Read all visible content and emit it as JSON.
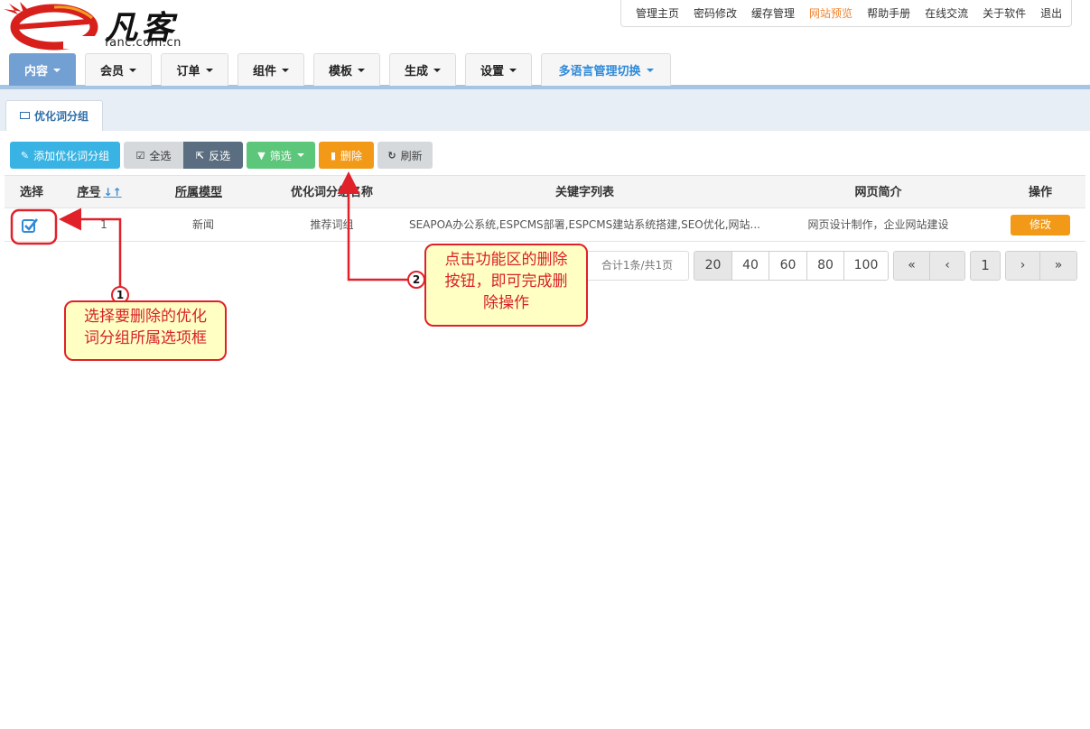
{
  "logo": {
    "text": "凡客",
    "domain": "fanc.com.cn"
  },
  "toplinks": [
    "管理主页",
    "密码修改",
    "缓存管理",
    "网站预览",
    "帮助手册",
    "在线交流",
    "关于软件",
    "退出"
  ],
  "nav": [
    "内容",
    "会员",
    "订单",
    "组件",
    "模板",
    "生成",
    "设置",
    "多语言管理切换"
  ],
  "subtab": {
    "label": "优化词分组",
    "icon": "monitor-icon"
  },
  "toolbar": {
    "add": "添加优化词分组",
    "select_all": "全选",
    "invert": "反选",
    "filter": "筛选",
    "delete": "删除",
    "refresh": "刷新"
  },
  "table": {
    "headers": [
      "选择",
      "序号",
      "所属模型",
      "优化词分组名称",
      "关键字列表",
      "网页简介",
      "操作"
    ],
    "row": {
      "checked": true,
      "id": "1",
      "model": "新闻",
      "name": "推荐词组",
      "keywords": "SEAPOA办公系统,ESPCMS部署,ESPCMS建站系统搭建,SEO优化,网站...",
      "intro": "网页设计制作，企业网站建设",
      "action": "修改"
    }
  },
  "pager": {
    "count": "合计1条/共1页",
    "sizes": [
      "20",
      "40",
      "60",
      "80",
      "100"
    ],
    "active_size": "20",
    "first": "«",
    "prev": "‹",
    "page": "1",
    "next": "›",
    "last": "»"
  },
  "callouts": {
    "one": {
      "num": "1",
      "text1": "选择要删除的优化",
      "text2": "词分组所属选项框"
    },
    "two": {
      "num": "2",
      "text1": "点击功能区的删除",
      "text2": "按钮，即可完成删",
      "text3": "除操作"
    }
  },
  "colors": {
    "accent": "#e0212a",
    "primary": "#39b3e3",
    "warning": "#f29a17",
    "nav_active": "#73a0d3"
  }
}
